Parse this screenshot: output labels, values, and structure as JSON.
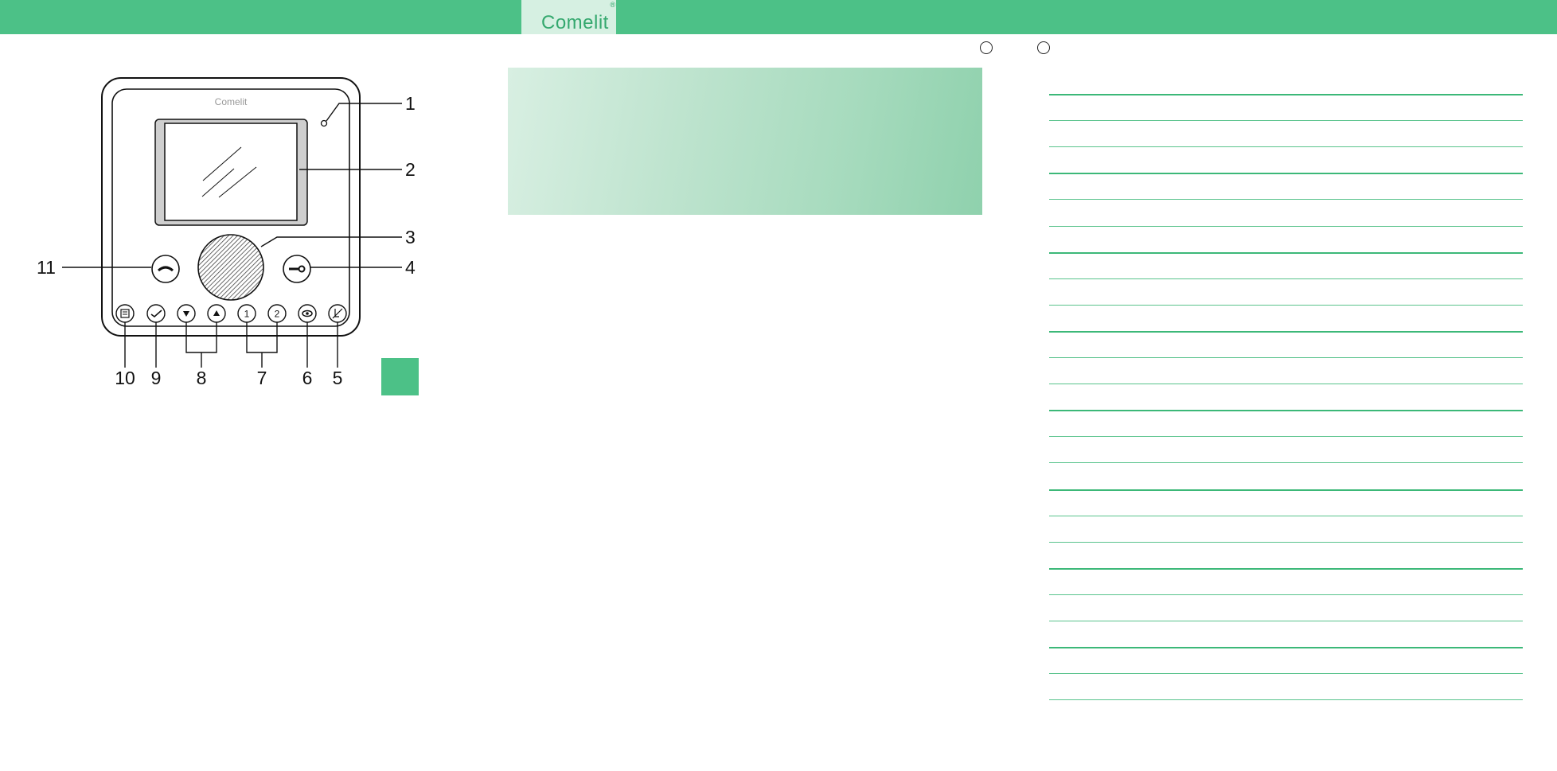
{
  "header": {
    "brand": "Comelit",
    "brand_mark": "®"
  },
  "device_diagram": {
    "screen_logo": "Comelit",
    "callouts": [
      "1",
      "2",
      "3",
      "4",
      "5",
      "6",
      "7",
      "8",
      "9",
      "10",
      "11"
    ],
    "button_labels": {
      "intercom_1": "1",
      "intercom_2": "2"
    }
  },
  "colors": {
    "brand_green": "#4cc187",
    "light_green": "#d3efe0",
    "rule_green": "#3cb878"
  },
  "lined_area": {
    "rule_count": 24
  }
}
